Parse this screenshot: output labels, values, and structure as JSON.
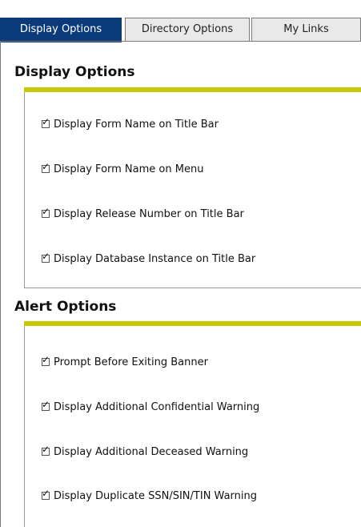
{
  "tabs": [
    {
      "label": "Display Options",
      "active": true
    },
    {
      "label": "Directory Options",
      "active": false
    },
    {
      "label": "My Links",
      "active": false
    }
  ],
  "display_section": {
    "title": "Display Options",
    "options": [
      {
        "label": "Display Form Name on Title Bar",
        "checked": true
      },
      {
        "label": "Display Form Name on Menu",
        "checked": true
      },
      {
        "label": "Display Release Number on Title Bar",
        "checked": true
      },
      {
        "label": "Display Database Instance on Title Bar",
        "checked": true
      }
    ]
  },
  "alert_section": {
    "title": "Alert Options",
    "options": [
      {
        "label": "Prompt Before Exiting Banner",
        "checked": true
      },
      {
        "label": "Display Additional Confidential Warning",
        "checked": true
      },
      {
        "label": "Display Additional Deceased Warning",
        "checked": true
      },
      {
        "label": "Display Duplicate SSN/SIN/TIN Warning",
        "checked": true
      }
    ]
  },
  "colors": {
    "active_tab": "#0b3a7a",
    "section_rule": "#c8c800"
  }
}
